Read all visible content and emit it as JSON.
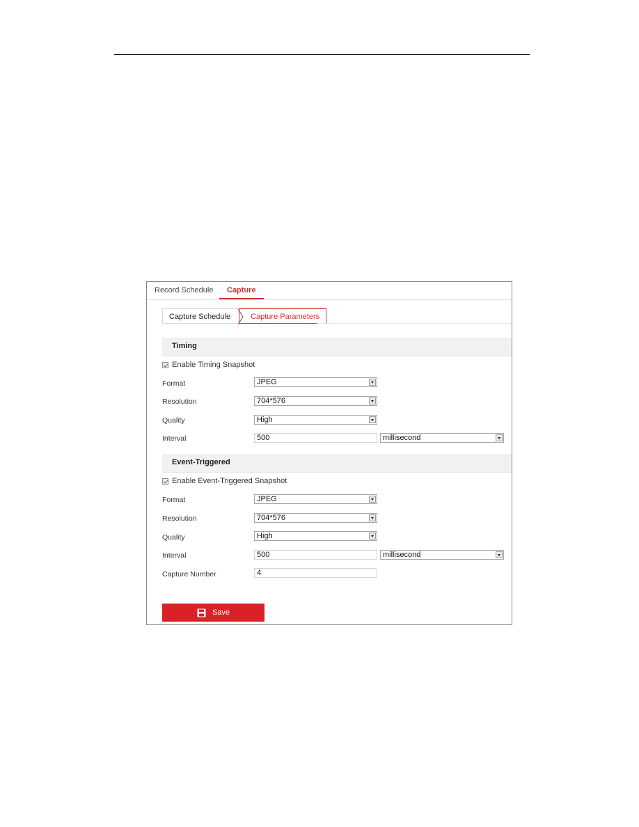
{
  "tabs": [
    {
      "label": "Record Schedule",
      "active": false
    },
    {
      "label": "Capture",
      "active": true
    }
  ],
  "subtabs": [
    {
      "label": "Capture Schedule",
      "active": false
    },
    {
      "label": "Capture Parameters",
      "active": true
    }
  ],
  "timing": {
    "title": "Timing",
    "enable_label": "Enable Timing Snapshot",
    "enabled": true,
    "format": {
      "label": "Format",
      "value": "JPEG"
    },
    "resolution": {
      "label": "Resolution",
      "value": "704*576"
    },
    "quality": {
      "label": "Quality",
      "value": "High"
    },
    "interval": {
      "label": "Interval",
      "value": "500",
      "unit": "millisecond"
    }
  },
  "event": {
    "title": "Event-Triggered",
    "enable_label": "Enable Event-Triggered Snapshot",
    "enabled": true,
    "format": {
      "label": "Format",
      "value": "JPEG"
    },
    "resolution": {
      "label": "Resolution",
      "value": "704*576"
    },
    "quality": {
      "label": "Quality",
      "value": "High"
    },
    "interval": {
      "label": "Interval",
      "value": "500",
      "unit": "millisecond"
    },
    "capture_number": {
      "label": "Capture Number",
      "value": "4"
    }
  },
  "save_label": "Save",
  "colors": {
    "accent": "#d32f2f",
    "save_button": "#da2128"
  }
}
